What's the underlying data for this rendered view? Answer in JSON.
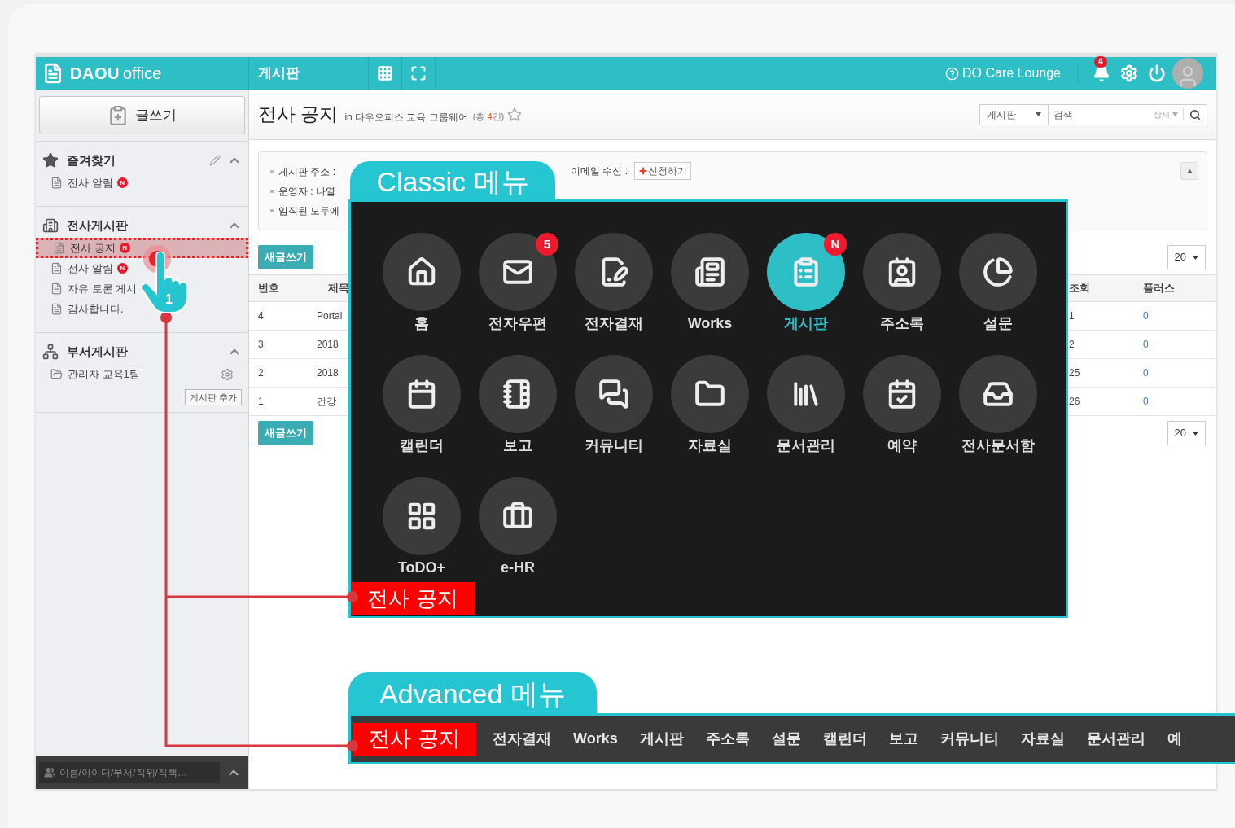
{
  "header": {
    "brand": "DAOU",
    "product": "office",
    "section_title": "게시판",
    "care_link": "DO Care Lounge",
    "notification_count": "4"
  },
  "sidebar": {
    "write_button": "글쓰기",
    "sections": [
      {
        "kind": "favorites",
        "title": "즐겨찾기",
        "editable": true,
        "items": [
          {
            "label": "전사 알림",
            "badge": "N",
            "selected": false
          }
        ]
      },
      {
        "kind": "company",
        "title": "전사게시판",
        "editable": false,
        "items": [
          {
            "label": "전사 공지",
            "badge": "N",
            "selected": true
          },
          {
            "label": "전사 알림",
            "badge": "N",
            "selected": false
          },
          {
            "label": "자유 토론 게시",
            "selected": false
          },
          {
            "label": "감사합니다.",
            "selected": false
          }
        ]
      },
      {
        "kind": "department",
        "title": "부서게시판",
        "editable": false,
        "items": [
          {
            "label": "관리자 교육1팀",
            "selected": false
          }
        ],
        "add_button": "게시판 추가"
      }
    ],
    "user_search": {
      "placeholder": "이름/아이디/부서/직위/직책…"
    }
  },
  "main": {
    "title": "전사 공지",
    "location": "in 다우오피스 교육 그룹웨어",
    "total_prefix": "(총",
    "total_count": "4",
    "total_suffix": "건)",
    "search": {
      "scope": "게시판",
      "placeholder": "검색",
      "detail": "상세"
    },
    "info": {
      "lines": [
        "게시판 주소 :",
        "운영자 : 나열",
        "임직원 모두에"
      ],
      "email_label": "이메일 수신 :",
      "subscribe_button": "신청하기"
    },
    "new_post_buttons": [
      "새글쓰기",
      "새글쓰기"
    ],
    "page_sizes": [
      "20",
      "20"
    ],
    "table": {
      "columns": [
        "번호",
        "제목",
        "조회",
        "플러스"
      ],
      "rows": [
        {
          "number": "4",
          "title": "Portal",
          "views": "1",
          "plus": "0"
        },
        {
          "number": "3",
          "title": "2018",
          "views": "2",
          "plus": "0"
        },
        {
          "number": "2",
          "title": "2018",
          "views": "25",
          "plus": "0"
        },
        {
          "number": "1",
          "title": "건강",
          "views": "26",
          "plus": "0"
        }
      ]
    }
  },
  "classic_menu": {
    "tab": "Classic 메뉴",
    "current_label": "전사 공지",
    "items": [
      {
        "label": "홈",
        "selected": false
      },
      {
        "label": "전자우편",
        "badge": "5",
        "selected": false
      },
      {
        "label": "전자결재",
        "selected": false
      },
      {
        "label": "Works",
        "selected": false
      },
      {
        "label": "게시판",
        "badge": "N",
        "selected": true
      },
      {
        "label": "주소록",
        "selected": false
      },
      {
        "label": "설문",
        "selected": false
      },
      {
        "label": "캘린더",
        "selected": false
      },
      {
        "label": "보고",
        "selected": false
      },
      {
        "label": "커뮤니티",
        "selected": false
      },
      {
        "label": "자료실",
        "selected": false
      },
      {
        "label": "문서관리",
        "selected": false
      },
      {
        "label": "예약",
        "selected": false
      },
      {
        "label": "전사문서함",
        "selected": false
      },
      {
        "label": "ToDO+",
        "selected": false
      },
      {
        "label": "e-HR",
        "selected": false
      }
    ]
  },
  "advanced_menu": {
    "tab": "Advanced 메뉴",
    "current_label": "전사 공지",
    "items": [
      "전자결재",
      "Works",
      "게시판",
      "주소록",
      "설문",
      "캘린더",
      "보고",
      "커뮤니티",
      "자료실",
      "문서관리",
      "예"
    ]
  },
  "annotation": {
    "step": "1"
  }
}
